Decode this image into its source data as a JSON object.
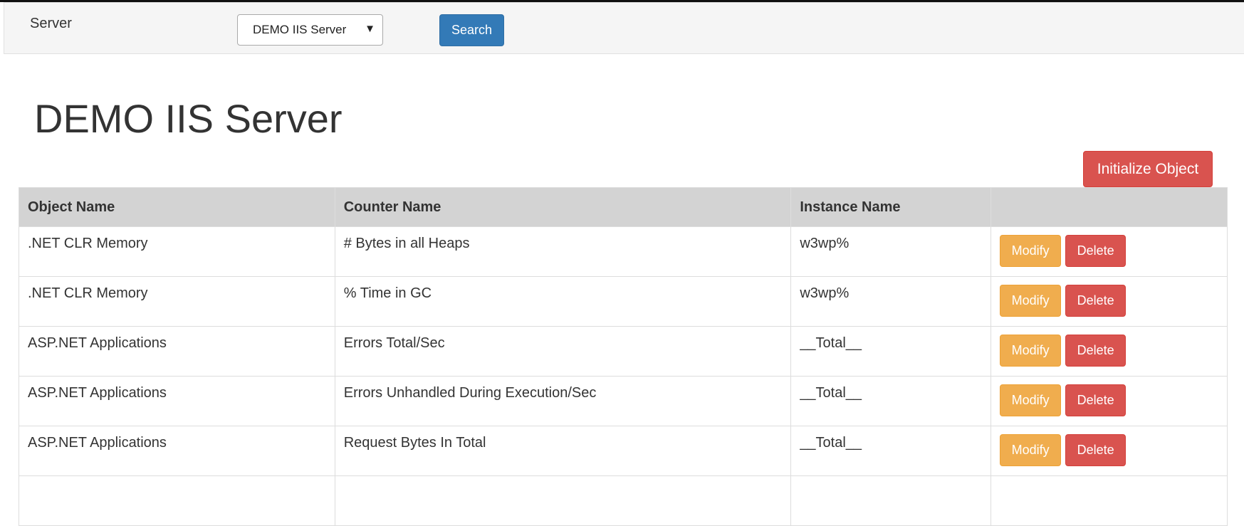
{
  "filter": {
    "server_label": "Server",
    "server_selected": "DEMO IIS Server",
    "caret": "▼",
    "search_label": "Search"
  },
  "page": {
    "title": "DEMO IIS Server",
    "initialize_label": "Initialize Object"
  },
  "table": {
    "headers": [
      "Object Name",
      "Counter Name",
      "Instance Name",
      ""
    ],
    "rows": [
      {
        "object": ".NET CLR Memory",
        "counter": "# Bytes in all Heaps",
        "instance": "w3wp%",
        "modify": "Modify",
        "delete": "Delete"
      },
      {
        "object": ".NET CLR Memory",
        "counter": "% Time in GC",
        "instance": "w3wp%",
        "modify": "Modify",
        "delete": "Delete"
      },
      {
        "object": "ASP.NET Applications",
        "counter": "Errors Total/Sec",
        "instance": "__Total__",
        "modify": "Modify",
        "delete": "Delete"
      },
      {
        "object": "ASP.NET Applications",
        "counter": "Errors Unhandled During Execution/Sec",
        "instance": "__Total__",
        "modify": "Modify",
        "delete": "Delete"
      },
      {
        "object": "ASP.NET Applications",
        "counter": "Request Bytes In Total",
        "instance": "__Total__",
        "modify": "Modify",
        "delete": "Delete"
      },
      {
        "object": "",
        "counter": "",
        "instance": "",
        "modify": "",
        "delete": ""
      }
    ]
  },
  "colors": {
    "primary": "#337ab7",
    "warning": "#f0ad4e",
    "danger": "#d9534f",
    "header_bg": "#d3d3d3"
  }
}
